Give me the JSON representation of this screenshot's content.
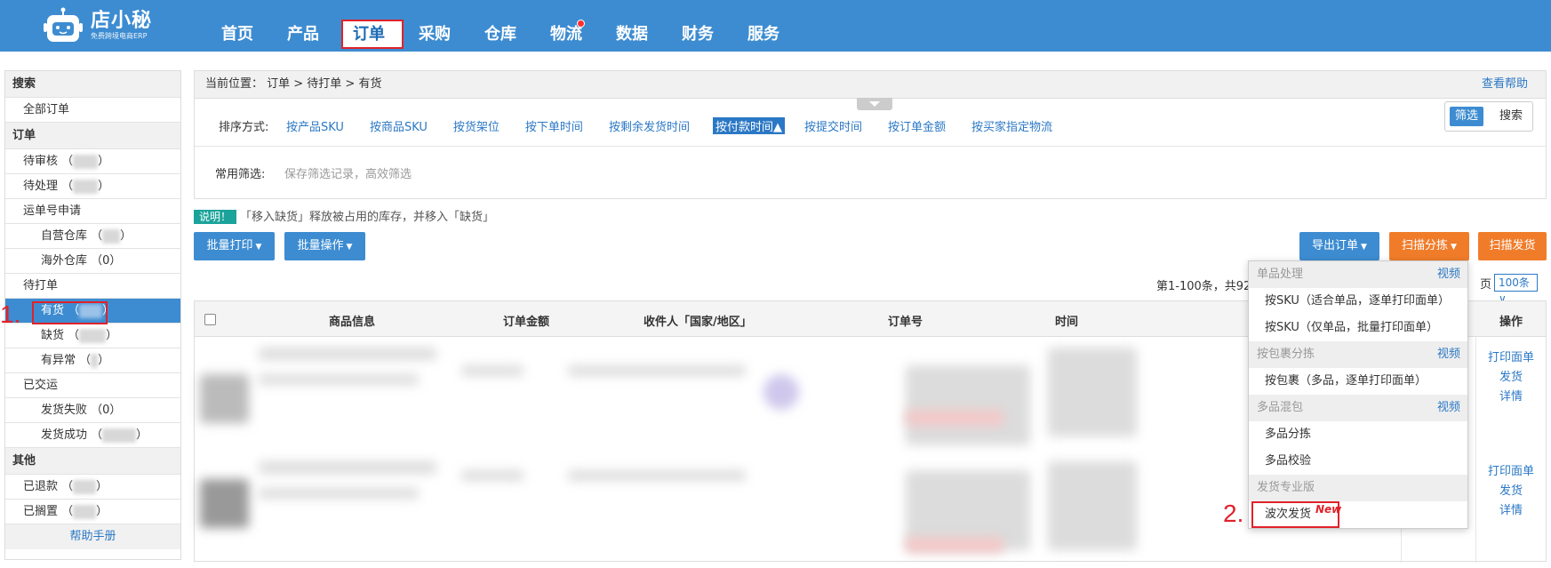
{
  "logo": {
    "name": "店小秘",
    "tagline": "免费跨境电商ERP"
  },
  "nav": {
    "items": [
      "首页",
      "产品",
      "订单",
      "采购",
      "仓库",
      "物流",
      "数据",
      "财务",
      "服务"
    ],
    "active_index": 2
  },
  "sidebar": {
    "search_head": "搜索",
    "all_orders": "全部订单",
    "orders_head": "订单",
    "pending_review": "待审核 （",
    "pending_process": "待处理 （",
    "waybill_apply": "运单号申请",
    "own_warehouse": "自营仓库 （",
    "overseas_warehouse": "海外仓库 （0）",
    "to_print": "待打单",
    "in_stock": "有货 （",
    "out_of_stock": "缺货 （",
    "abnormal": "有异常 （",
    "delivered": "已交运",
    "ship_failed": "发货失败 （0）",
    "ship_success": "发货成功 （",
    "close_paren": "）",
    "other_head": "其他",
    "refunded": "已退款 （",
    "on_hold": "已搁置 （",
    "help": "帮助手册"
  },
  "annotations": {
    "step1": "1.",
    "step2": "2."
  },
  "breadcrumb": {
    "text": "当前位置： 订单 > 待打单 > 有货",
    "help": "查看帮助"
  },
  "sort": {
    "label": "排序方式:",
    "options": [
      "按产品SKU",
      "按商品SKU",
      "按货架位",
      "按下单时间",
      "按剩余发货时间",
      "按付款时间▲",
      "按提交时间",
      "按订单金额",
      "按买家指定物流"
    ],
    "active_index": 5
  },
  "toggle": {
    "filter": "筛选",
    "search": "搜索"
  },
  "common_filter": {
    "label": "常用筛选:",
    "placeholder": "保存筛选记录，高效筛选"
  },
  "notice": {
    "badge": "说明！",
    "text": "「移入缺货」释放被占用的库存，并移入「缺货」"
  },
  "buttons": {
    "batch_print": "批量打印",
    "batch_ops": "批量操作",
    "export": "导出订单",
    "scan_sort": "扫描分拣",
    "scan_ship": "扫描发货"
  },
  "paging": {
    "summary": "第1-100条，共92",
    "per_page_suffix": "页",
    "per_page": "100条"
  },
  "table": {
    "headers": [
      "商品信息",
      "订单金额",
      "收件人「国家/地区」",
      "订单号",
      "时间",
      "操作"
    ],
    "row_ops": [
      "打印面单",
      "发货",
      "详情"
    ]
  },
  "dropdown": {
    "sections": [
      {
        "title": "单品处理",
        "video": "视频",
        "items": [
          "按SKU（适合单品，逐单打印面单）",
          "按SKU（仅单品，批量打印面单）"
        ]
      },
      {
        "title": "按包裹分拣",
        "video": "视频",
        "items": [
          "按包裹（多品，逐单打印面单）"
        ]
      },
      {
        "title": "多品混包",
        "video": "视频",
        "items": [
          "多品分拣",
          "多品校验"
        ]
      },
      {
        "title": "发货专业版",
        "video": "",
        "items": [
          "波次发货"
        ]
      }
    ],
    "new_badge": "New"
  },
  "colors": {
    "nav_bg": "#3d8cd1",
    "link": "#2b78c5",
    "accent_orange": "#f07c2a",
    "highlight_red": "#e0222a"
  }
}
